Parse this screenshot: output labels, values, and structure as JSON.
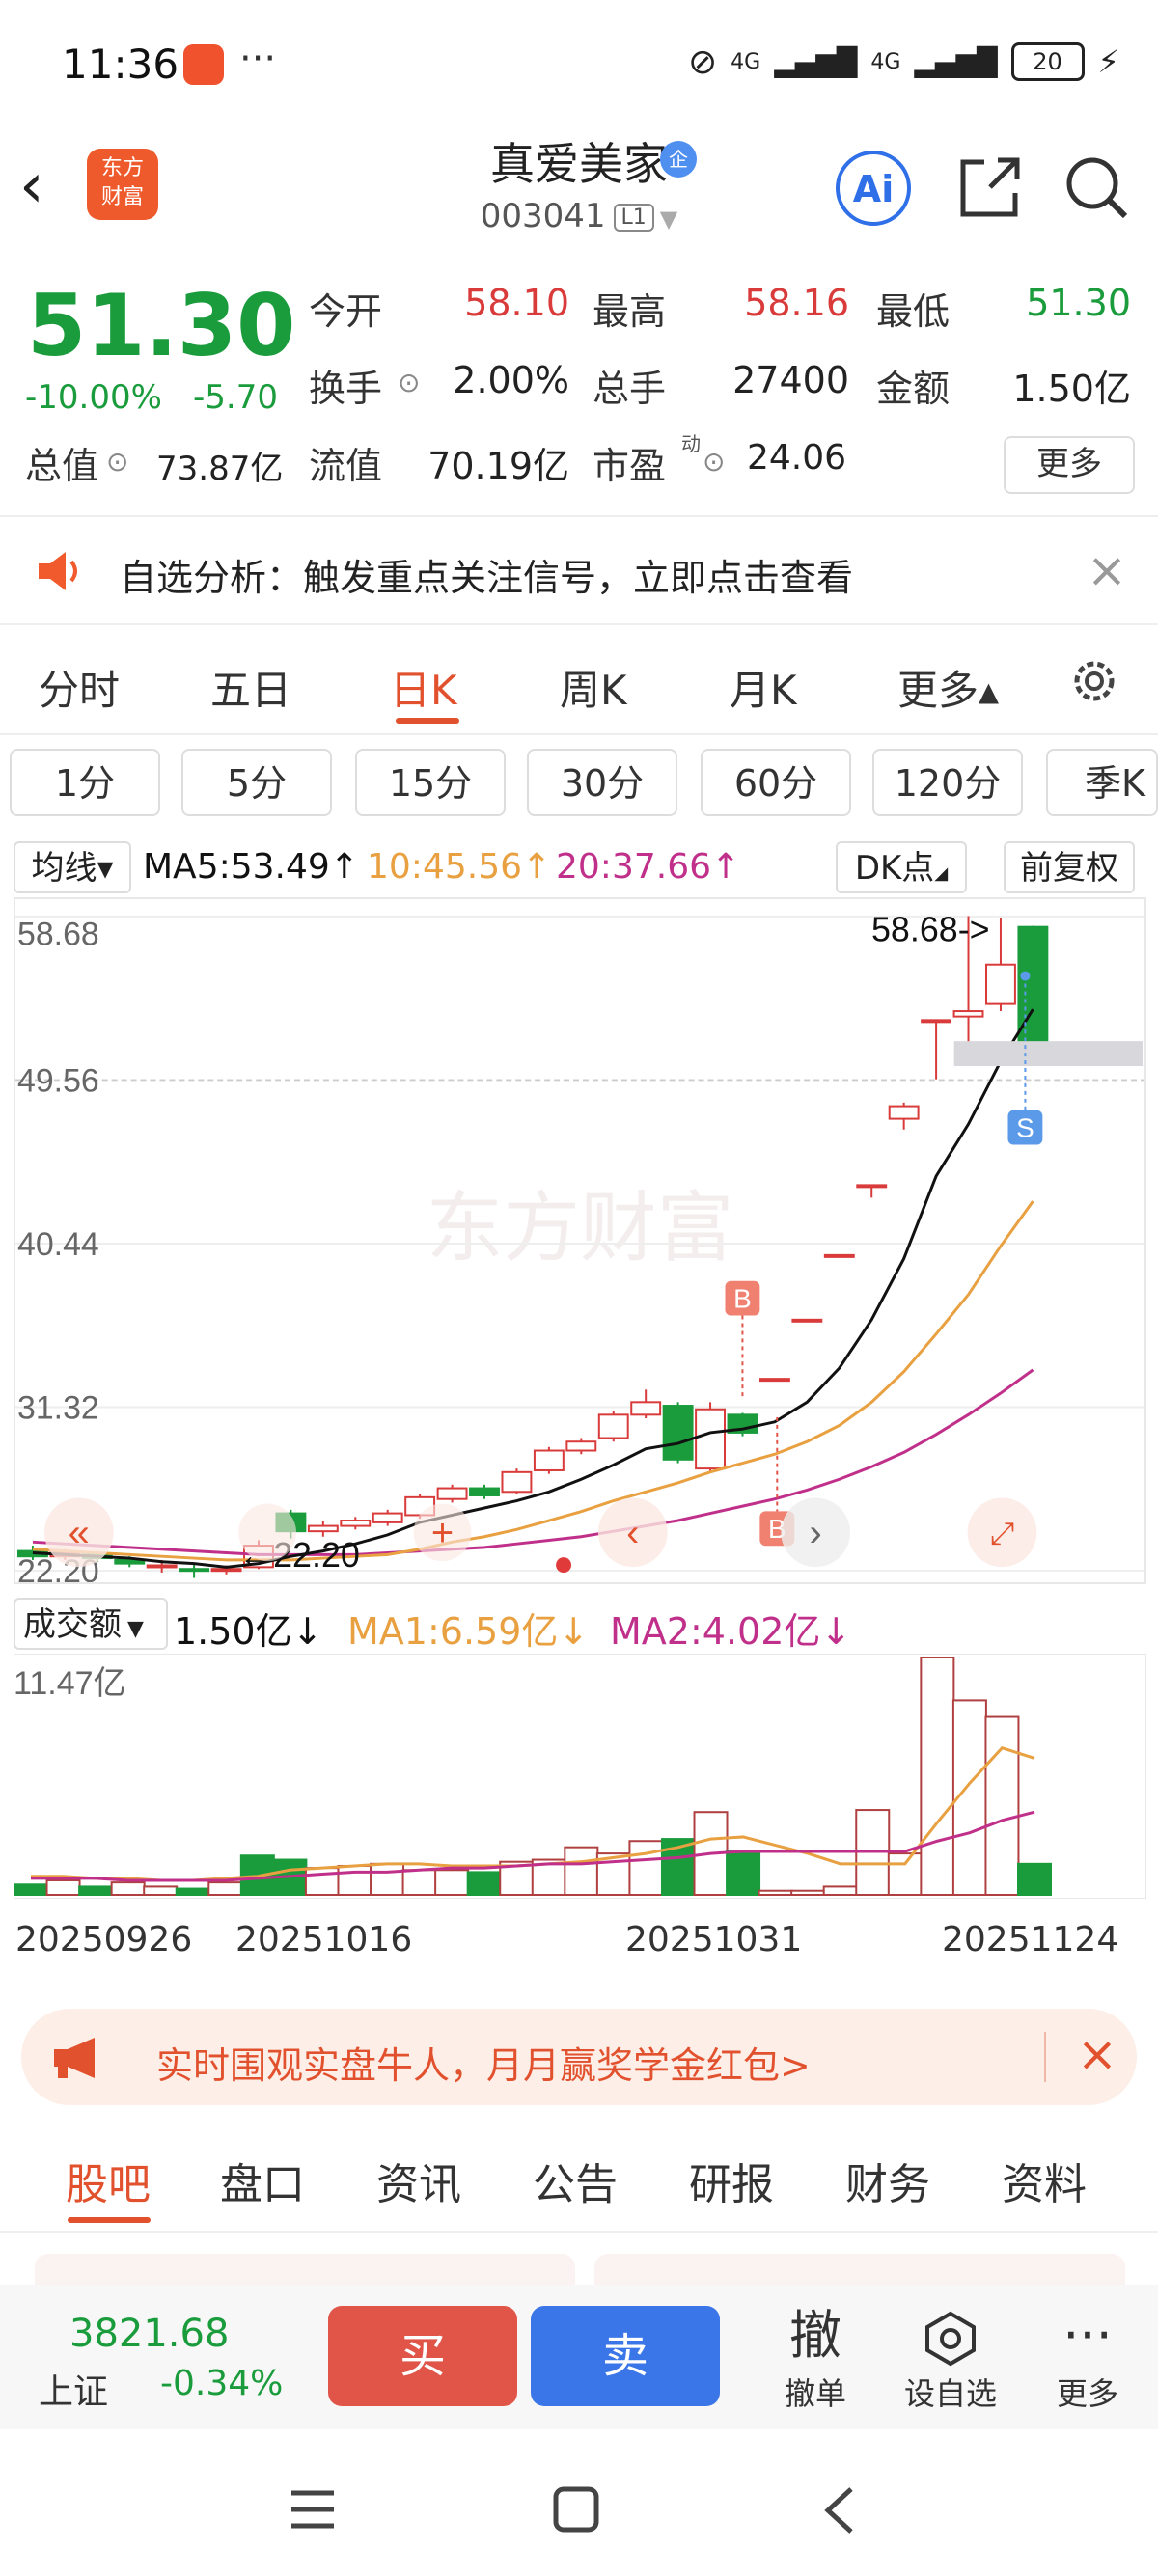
{
  "status": {
    "time": "11:36",
    "signal1": "4G",
    "signal2": "4G",
    "battery": "20"
  },
  "header": {
    "back": "‹",
    "logo_line1": "东方",
    "logo_line2": "财富",
    "name": "真爱美家",
    "badge": "企",
    "code": "003041",
    "level": "L1",
    "ai": "Ai"
  },
  "quote": {
    "price": "51.30",
    "pct": "-10.00%",
    "change": "-5.70",
    "open_label": "今开",
    "open": "58.10",
    "high_label": "最高",
    "high": "58.16",
    "low_label": "最低",
    "low": "51.30",
    "turnover_label": "换手",
    "turnover": "2.00%",
    "volume_label": "总手",
    "volume": "27400",
    "amount_label": "金额",
    "amount": "1.50亿",
    "total_cap_label": "总值",
    "total_cap": "73.87亿",
    "float_cap_label": "流值",
    "float_cap": "70.19亿",
    "pe_label": "市盈",
    "pe_sup": "动",
    "pe": "24.06",
    "more": "更多"
  },
  "notice": {
    "text": "自选分析：触发重点关注信号，立即点击查看"
  },
  "period_tabs": [
    "分时",
    "五日",
    "日K",
    "周K",
    "月K",
    "更多▴"
  ],
  "minute_tabs": [
    "1分",
    "5分",
    "15分",
    "30分",
    "60分",
    "120分",
    "季K"
  ],
  "ma_row": {
    "selector": "均线▾",
    "ma5": "MA5:53.49↑",
    "ma10": "10:45.56↑",
    "ma20": "20:37.66↑",
    "dk": "DK点",
    "adjust": "前复权"
  },
  "kchart": {
    "y_labels": [
      "58.68",
      "49.56",
      "40.44",
      "31.32",
      "22.20"
    ],
    "max_label": "58.68->",
    "min_label": "←22.20",
    "watermark": "东方财富",
    "marker_b": "B",
    "marker_s": "S"
  },
  "volume_row": {
    "selector": "成交额",
    "value": "1.50亿↓",
    "ma1": "MA1:6.59亿↓",
    "ma2": "MA2:4.02亿↓",
    "max_label": "11.47亿"
  },
  "dates": [
    "20250926",
    "20251016",
    "20251031",
    "20251124"
  ],
  "banner": {
    "text": "实时围观实盘牛人，月月赢奖学金红包>"
  },
  "bottom_tabs": [
    "股吧",
    "盘口",
    "资讯",
    "公告",
    "研报",
    "财务",
    "资料"
  ],
  "index": {
    "value": "3821.68",
    "name": "上证",
    "pct": "-0.34%"
  },
  "actions": {
    "buy": "买",
    "sell": "卖",
    "cancel_icon": "撤",
    "cancel": "撤单",
    "watch": "设自选",
    "more": "更多"
  },
  "colors": {
    "up": "#d93a3a",
    "down": "#1a9c3c",
    "accent": "#e2512e",
    "ma5": "#111111",
    "ma10": "#e8a040",
    "ma20": "#c0308a"
  },
  "chart_data": {
    "type": "candlestick",
    "ylim": [
      22.2,
      58.68
    ],
    "candles": [
      {
        "o": 23.3,
        "c": 23.0,
        "h": 23.6,
        "l": 22.8
      },
      {
        "o": 23.0,
        "c": 23.2,
        "h": 23.4,
        "l": 22.8
      },
      {
        "o": 23.1,
        "c": 22.9,
        "h": 23.3,
        "l": 22.7
      },
      {
        "o": 22.8,
        "c": 22.6,
        "h": 23.0,
        "l": 22.4
      },
      {
        "o": 22.4,
        "c": 22.5,
        "h": 22.8,
        "l": 22.1
      },
      {
        "o": 22.3,
        "c": 22.2,
        "h": 22.6,
        "l": 21.8
      },
      {
        "o": 22.2,
        "c": 22.3,
        "h": 22.5,
        "l": 22.0
      },
      {
        "o": 22.4,
        "c": 23.6,
        "h": 23.9,
        "l": 22.3
      },
      {
        "o": 25.4,
        "c": 24.4,
        "h": 25.6,
        "l": 24.0
      },
      {
        "o": 24.4,
        "c": 24.7,
        "h": 25.0,
        "l": 24.1
      },
      {
        "o": 24.7,
        "c": 25.0,
        "h": 25.2,
        "l": 24.5
      },
      {
        "o": 24.9,
        "c": 25.4,
        "h": 25.6,
        "l": 24.7
      },
      {
        "o": 25.3,
        "c": 26.3,
        "h": 26.5,
        "l": 25.1
      },
      {
        "o": 26.2,
        "c": 26.8,
        "h": 27.0,
        "l": 26.0
      },
      {
        "o": 26.8,
        "c": 26.4,
        "h": 27.0,
        "l": 26.2
      },
      {
        "o": 26.6,
        "c": 27.7,
        "h": 27.9,
        "l": 26.5
      },
      {
        "o": 27.8,
        "c": 28.9,
        "h": 29.1,
        "l": 27.6
      },
      {
        "o": 28.9,
        "c": 29.4,
        "h": 29.6,
        "l": 28.7
      },
      {
        "o": 29.6,
        "c": 30.9,
        "h": 31.1,
        "l": 29.4
      },
      {
        "o": 30.9,
        "c": 31.6,
        "h": 32.3,
        "l": 30.7
      },
      {
        "o": 31.4,
        "c": 28.4,
        "h": 31.6,
        "l": 28.2
      },
      {
        "o": 27.9,
        "c": 31.2,
        "h": 31.6,
        "l": 27.7
      },
      {
        "o": 30.9,
        "c": 29.9,
        "h": 31.0,
        "l": 29.7
      },
      {
        "o": 32.9,
        "c": 32.9,
        "h": 32.9,
        "l": 32.9
      },
      {
        "o": 36.2,
        "c": 36.2,
        "h": 36.2,
        "l": 36.2
      },
      {
        "o": 39.8,
        "c": 39.8,
        "h": 39.8,
        "l": 39.8
      },
      {
        "o": 43.7,
        "c": 43.7,
        "h": 43.7,
        "l": 43.0
      },
      {
        "o": 47.4,
        "c": 48.1,
        "h": 48.3,
        "l": 46.8
      },
      {
        "o": 52.9,
        "c": 52.9,
        "h": 52.9,
        "l": 49.6
      },
      {
        "o": 53.1,
        "c": 53.4,
        "h": 58.7,
        "l": 50.6
      },
      {
        "o": 53.8,
        "c": 56.0,
        "h": 58.6,
        "l": 53.4
      },
      {
        "o": 58.1,
        "c": 51.3,
        "h": 58.16,
        "l": 51.3
      }
    ],
    "ma5": [
      23.2,
      23.1,
      23.0,
      22.9,
      22.7,
      22.6,
      22.4,
      22.6,
      23.0,
      23.3,
      23.7,
      24.2,
      24.9,
      25.3,
      25.7,
      26.1,
      26.6,
      27.3,
      28.1,
      29.0,
      29.3,
      29.9,
      30.1,
      30.5,
      31.6,
      33.5,
      36.2,
      39.6,
      44.2,
      47.1,
      50.6,
      53.5
    ],
    "ma10": [
      23.4,
      23.3,
      23.2,
      23.1,
      23.0,
      22.9,
      22.8,
      22.8,
      22.8,
      22.9,
      23.0,
      23.1,
      23.4,
      23.8,
      24.1,
      24.5,
      25.0,
      25.5,
      26.1,
      26.6,
      27.1,
      27.7,
      28.2,
      28.7,
      29.4,
      30.3,
      31.6,
      33.3,
      35.4,
      37.6,
      40.3,
      42.8
    ],
    "ma20": [
      23.8,
      23.7,
      23.6,
      23.5,
      23.4,
      23.3,
      23.2,
      23.1,
      23.1,
      23.1,
      23.1,
      23.2,
      23.3,
      23.4,
      23.5,
      23.7,
      23.9,
      24.1,
      24.4,
      24.7,
      25.0,
      25.4,
      25.8,
      26.2,
      26.7,
      27.3,
      28.0,
      28.8,
      29.8,
      30.9,
      32.1,
      33.4
    ],
    "volume": {
      "ylim": [
        0,
        11.47
      ],
      "bars": [
        0.5,
        0.7,
        0.4,
        0.6,
        0.4,
        0.3,
        0.6,
        1.9,
        1.7,
        1.3,
        1.4,
        1.5,
        1.2,
        1.2,
        1.1,
        1.6,
        1.7,
        2.3,
        2.0,
        2.6,
        2.7,
        4.0,
        2.1,
        0.2,
        0.2,
        0.4,
        4.1,
        2.0,
        11.47,
        9.4,
        8.6,
        1.5
      ],
      "ma1": [
        0.9,
        0.9,
        0.8,
        0.8,
        0.7,
        0.7,
        0.8,
        0.9,
        1.2,
        1.3,
        1.4,
        1.5,
        1.5,
        1.4,
        1.4,
        1.4,
        1.5,
        1.6,
        1.8,
        2.0,
        2.3,
        2.7,
        2.8,
        2.4,
        2.0,
        1.5,
        1.5,
        1.5,
        3.5,
        5.4,
        7.1,
        6.6
      ],
      "ma2": [
        0.8,
        0.8,
        0.8,
        0.7,
        0.7,
        0.7,
        0.7,
        0.8,
        0.9,
        1.0,
        1.1,
        1.1,
        1.2,
        1.3,
        1.3,
        1.4,
        1.5,
        1.5,
        1.6,
        1.7,
        1.8,
        2.0,
        2.1,
        2.1,
        2.1,
        2.1,
        2.1,
        2.1,
        2.6,
        3.0,
        3.6,
        4.0
      ],
      "up": [
        false,
        true,
        false,
        true,
        true,
        false,
        true,
        false,
        false,
        true,
        true,
        true,
        true,
        true,
        false,
        true,
        true,
        true,
        true,
        true,
        false,
        true,
        false,
        true,
        true,
        true,
        true,
        true,
        true,
        true,
        true,
        false
      ]
    }
  }
}
